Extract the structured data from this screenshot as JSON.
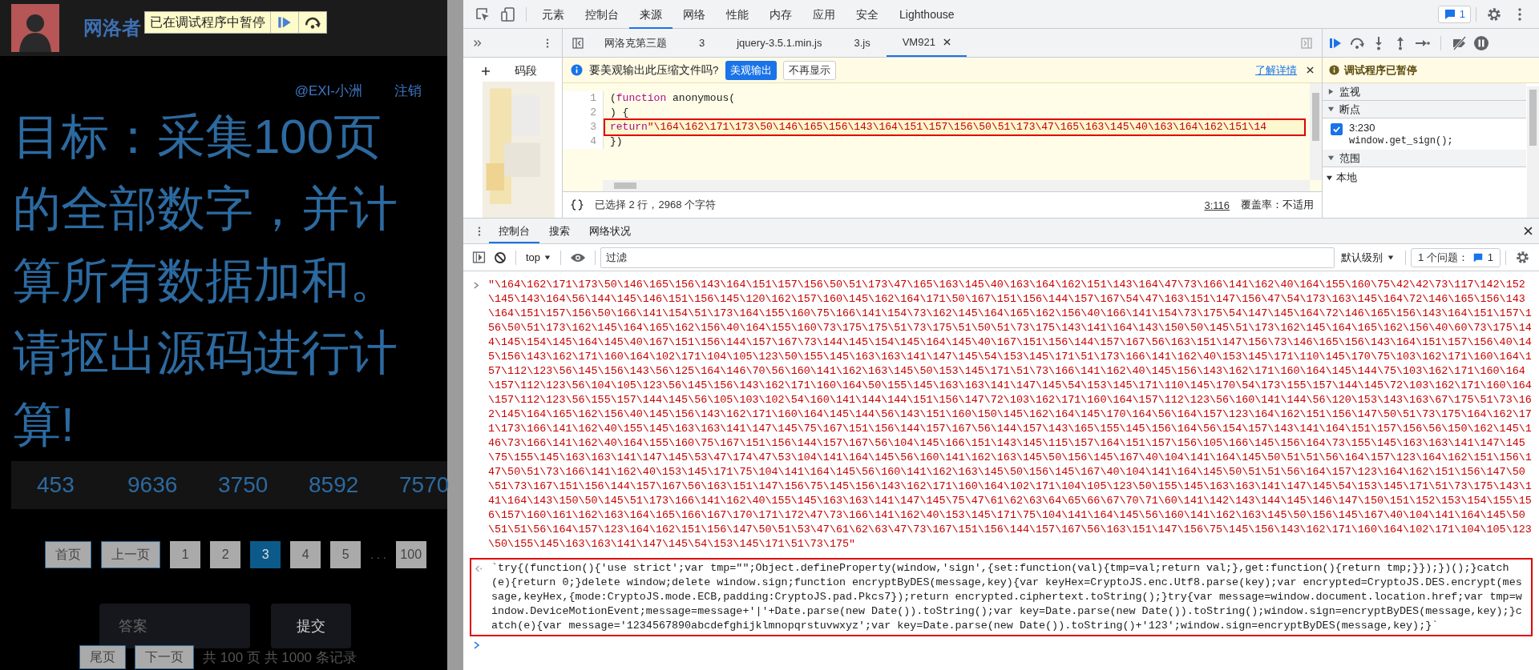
{
  "page": {
    "header": {
      "title": "网洛者",
      "paused_badge": "已在调试程序中暂停"
    },
    "user_links": [
      "@EXI-小洲",
      "注销"
    ],
    "heading": "目标：采集100页的全部数字，并计算所有数据加和。请抠出源码进行计算!",
    "numbers": [
      "453",
      "9636",
      "3750",
      "8592",
      "7570"
    ],
    "pagination": [
      {
        "label": "首页",
        "kind": "nav"
      },
      {
        "label": "上一页",
        "kind": "nav"
      },
      {
        "label": "1",
        "kind": "page",
        "selected": false
      },
      {
        "label": "2",
        "kind": "page",
        "selected": false
      },
      {
        "label": "3",
        "kind": "page",
        "selected": true
      },
      {
        "label": "4",
        "kind": "page",
        "selected": false
      },
      {
        "label": "5",
        "kind": "page",
        "selected": false
      },
      {
        "label": ". . .",
        "kind": "ellipsis"
      },
      {
        "label": "100",
        "kind": "page",
        "selected": false
      }
    ],
    "answer_field": {
      "placeholder": "答案"
    },
    "submit": "提交",
    "bottom_nav": [
      "尾页",
      "下一页"
    ],
    "record_count": "共 100 页 共 1000 条记录"
  },
  "devtools": {
    "tabs": [
      {
        "label": "元素",
        "selected": false
      },
      {
        "label": "控制台",
        "selected": false
      },
      {
        "label": "来源",
        "selected": true
      },
      {
        "label": "网络",
        "selected": false
      },
      {
        "label": "性能",
        "selected": false
      },
      {
        "label": "内存",
        "selected": false
      },
      {
        "label": "应用",
        "selected": false
      },
      {
        "label": "安全",
        "selected": false
      },
      {
        "label": "Lighthouse",
        "selected": false
      }
    ],
    "issues_badge": "1",
    "navigator": {
      "snippets_label": "码段"
    },
    "file_tabs": [
      {
        "label": "网洛克第三题",
        "selected": false
      },
      {
        "label": "3",
        "selected": false
      },
      {
        "label": "jquery-3.5.1.min.js",
        "selected": false
      },
      {
        "label": "3.js",
        "selected": false
      },
      {
        "label": "VM921",
        "selected": true
      }
    ],
    "infobar": {
      "message": "要美观输出此压缩文件吗?",
      "primary": "美观输出",
      "secondary": "不再显示",
      "link": "了解详情"
    },
    "code_lines": [
      {
        "number": "1",
        "highlighted": false,
        "tokens": [
          {
            "kind": "plain",
            "text": "("
          },
          {
            "kind": "keyword",
            "text": "function"
          },
          {
            "kind": "plain",
            "text": " anonymous("
          }
        ]
      },
      {
        "number": "2",
        "highlighted": false,
        "tokens": [
          {
            "kind": "plain",
            "text": ") {"
          }
        ]
      },
      {
        "number": "3",
        "highlighted": true,
        "tokens": [
          {
            "kind": "keyword",
            "text": "return"
          },
          {
            "kind": "string",
            "text": "\"\\164\\162\\171\\173\\50\\146\\165\\156\\143\\164\\151\\157\\156\\50\\51\\173\\47\\165\\163\\145\\40\\163\\164\\162\\151\\14"
          }
        ]
      },
      {
        "number": "4",
        "highlighted": false,
        "tokens": [
          {
            "kind": "plain",
            "text": "})"
          }
        ]
      }
    ],
    "status": {
      "selection": "已选择 2 行，2968 个字符",
      "position": "3:116",
      "coverage": "覆盖率：不适用"
    },
    "debugger": {
      "paused": "调试程序已暂停",
      "sections": [
        {
          "title": "监视",
          "expanded": false
        },
        {
          "kind": "breakpoints",
          "title": "断点",
          "expanded": true,
          "items": [
            {
              "location": "3:230",
              "code": "window.get_sign();",
              "checked": true
            }
          ]
        },
        {
          "kind": "scope",
          "title": "范围",
          "expanded": true,
          "items": [
            {
              "title": "本地",
              "expanded": true
            }
          ]
        }
      ]
    },
    "drawer_tabs": [
      {
        "label": "控制台",
        "selected": true
      },
      {
        "label": "搜索",
        "selected": false
      },
      {
        "label": "网络状况",
        "selected": false
      }
    ],
    "console_toolbar": {
      "context": "top",
      "filter_placeholder": "过滤",
      "level": "默认级别",
      "issues": "1 个问题：",
      "issues_count": "1"
    },
    "console_messages": [
      {
        "kind": "input",
        "highlighted": false,
        "text": "\"\\164\\162\\171\\173\\50\\146\\165\\156\\143\\164\\151\\157\\156\\50\\51\\173\\47\\165\\163\\145\\40\\163\\164\\162\\151\\143\\164\\47\\73\\166\\141\\162\\40\\164\\155\\160\\75\\42\\42\\73\\117\\142\\152\\145\\143\\164\\56\\144\\145\\146\\151\\156\\145\\120\\162\\157\\160\\145\\162\\164\\171\\50\\167\\151\\156\\144\\157\\167\\54\\47\\163\\151\\147\\156\\47\\54\\173\\163\\145\\164\\72\\146\\165\\156\\143\\164\\151\\157\\156\\50\\166\\141\\154\\51\\173\\164\\155\\160\\75\\166\\141\\154\\73\\162\\145\\164\\165\\162\\156\\40\\166\\141\\154\\73\\175\\54\\147\\145\\164\\72\\146\\165\\156\\143\\164\\151\\157\\156\\50\\51\\173\\162\\145\\164\\165\\162\\156\\40\\164\\155\\160\\73\\175\\175\\51\\73\\175\\51\\50\\51\\73\\175\\143\\141\\164\\143\\150\\50\\145\\51\\173\\162\\145\\164\\165\\162\\156\\40\\60\\73\\175\\144\\145\\154\\145\\164\\145\\40\\167\\151\\156\\144\\157\\167\\73\\144\\145\\154\\145\\164\\145\\40\\167\\151\\156\\144\\157\\167\\56\\163\\151\\147\\156\\73\\146\\165\\156\\143\\164\\151\\157\\156\\40\\145\\156\\143\\162\\171\\160\\164\\102\\171\\104\\105\\123\\50\\155\\145\\163\\163\\141\\147\\145\\54\\153\\145\\171\\51\\173\\166\\141\\162\\40\\153\\145\\171\\110\\145\\170\\75\\103\\162\\171\\160\\164\\157\\112\\123\\56\\145\\156\\143\\56\\125\\164\\146\\70\\56\\160\\141\\162\\163\\145\\50\\153\\145\\171\\51\\73\\166\\141\\162\\40\\145\\156\\143\\162\\171\\160\\164\\145\\144\\75\\103\\162\\171\\160\\164\\157\\112\\123\\56\\104\\105\\123\\56\\145\\156\\143\\162\\171\\160\\164\\50\\155\\145\\163\\163\\141\\147\\145\\54\\153\\145\\171\\110\\145\\170\\54\\173\\155\\157\\144\\145\\72\\103\\162\\171\\160\\164\\157\\112\\123\\56\\155\\157\\144\\145\\56\\105\\103\\102\\54\\160\\141\\144\\144\\151\\156\\147\\72\\103\\162\\171\\160\\164\\157\\112\\123\\56\\160\\141\\144\\56\\120\\153\\143\\163\\67\\175\\51\\73\\162\\145\\164\\165\\162\\156\\40\\145\\156\\143\\162\\171\\160\\164\\145\\144\\56\\143\\151\\160\\150\\145\\162\\164\\145\\170\\164\\56\\164\\157\\123\\164\\162\\151\\156\\147\\50\\51\\73\\175\\164\\162\\171\\173\\166\\141\\162\\40\\155\\145\\163\\163\\141\\147\\145\\75\\167\\151\\156\\144\\157\\167\\56\\144\\157\\143\\165\\155\\145\\156\\164\\56\\154\\157\\143\\141\\164\\151\\157\\156\\56\\150\\162\\145\\146\\73\\166\\141\\162\\40\\164\\155\\160\\75\\167\\151\\156\\144\\157\\167\\56\\104\\145\\166\\151\\143\\145\\115\\157\\164\\151\\157\\156\\105\\166\\145\\156\\164\\73\\155\\145\\163\\163\\141\\147\\145\\75\\155\\145\\163\\163\\141\\147\\145\\53\\47\\174\\47\\53\\104\\141\\164\\145\\56\\160\\141\\162\\163\\145\\50\\156\\145\\167\\40\\104\\141\\164\\145\\50\\51\\51\\56\\164\\157\\123\\164\\162\\151\\156\\147\\50\\51\\73\\166\\141\\162\\40\\153\\145\\171\\75\\104\\141\\164\\145\\56\\160\\141\\162\\163\\145\\50\\156\\145\\167\\40\\104\\141\\164\\145\\50\\51\\51\\56\\164\\157\\123\\164\\162\\151\\156\\147\\50\\51\\73\\167\\151\\156\\144\\157\\167\\56\\163\\151\\147\\156\\75\\145\\156\\143\\162\\171\\160\\164\\102\\171\\104\\105\\123\\50\\155\\145\\163\\163\\141\\147\\145\\54\\153\\145\\171\\51\\73\\175\\143\\141\\164\\143\\150\\50\\145\\51\\173\\166\\141\\162\\40\\155\\145\\163\\163\\141\\147\\145\\75\\47\\61\\62\\63\\64\\65\\66\\67\\70\\71\\60\\141\\142\\143\\144\\145\\146\\147\\150\\151\\152\\153\\154\\155\\156\\157\\160\\161\\162\\163\\164\\165\\166\\167\\170\\171\\172\\47\\73\\166\\141\\162\\40\\153\\145\\171\\75\\104\\141\\164\\145\\56\\160\\141\\162\\163\\145\\50\\156\\145\\167\\40\\104\\141\\164\\145\\50\\51\\51\\56\\164\\157\\123\\164\\162\\151\\156\\147\\50\\51\\53\\47\\61\\62\\63\\47\\73\\167\\151\\156\\144\\157\\167\\56\\163\\151\\147\\156\\75\\145\\156\\143\\162\\171\\160\\164\\102\\171\\104\\105\\123\\50\\155\\145\\163\\163\\141\\147\\145\\54\\153\\145\\171\\51\\73\\175\""
      },
      {
        "kind": "output",
        "highlighted": true,
        "text": "`try{(function(){'use strict';var tmp=\"\";Object.defineProperty(window,'sign',{set:function(val){tmp=val;return val;},get:function(){return tmp;}});})();}catch(e){return 0;}delete window;delete window.sign;function encryptByDES(message,key){var keyHex=CryptoJS.enc.Utf8.parse(key);var encrypted=CryptoJS.DES.encrypt(message,keyHex,{mode:CryptoJS.mode.ECB,padding:CryptoJS.pad.Pkcs7});return encrypted.ciphertext.toString();}try{var message=window.document.location.href;var tmp=window.DeviceMotionEvent;message=message+'|'+Date.parse(new Date()).toString();var key=Date.parse(new Date()).toString();window.sign=encryptByDES(message,key);}catch(e){var message='1234567890abcdefghijklmnopqrstuvwxyz';var key=Date.parse(new Date()).toString()+'123';window.sign=encryptByDES(message,key);}`"
      }
    ]
  }
}
